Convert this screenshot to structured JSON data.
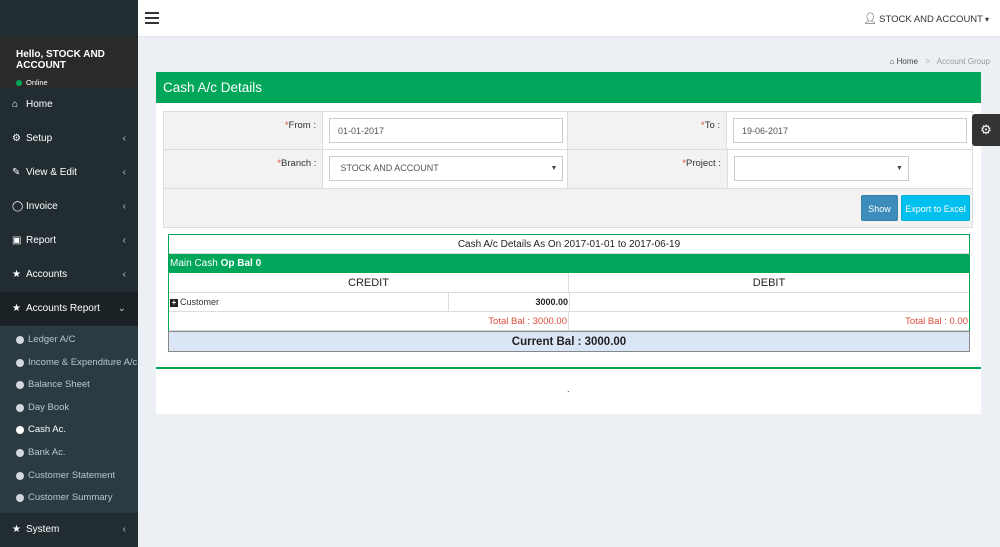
{
  "sidebar": {
    "greeting": "Hello, STOCK AND ACCOUNT",
    "status": "Online",
    "items": [
      {
        "label": "Home",
        "icon": "home-icon",
        "has_chevron": false
      },
      {
        "label": "Setup",
        "icon": "cogs-icon",
        "has_chevron": true
      },
      {
        "label": "View & Edit",
        "icon": "edit-icon",
        "has_chevron": true
      },
      {
        "label": "Invoice",
        "icon": "invoice-icon",
        "has_chevron": true
      },
      {
        "label": "Report",
        "icon": "file-icon",
        "has_chevron": true
      },
      {
        "label": "Accounts",
        "icon": "star-icon",
        "has_chevron": true
      },
      {
        "label": "Accounts Report",
        "icon": "star-icon",
        "has_chevron": true
      },
      {
        "label": "System",
        "icon": "star-icon",
        "has_chevron": true
      }
    ],
    "submenu": [
      "Ledger A/C",
      "Income & Expenditure A/c",
      "Balance Sheet",
      "Day Book",
      "Cash Ac.",
      "Bank Ac.",
      "Customer Statement",
      "Customer Summary"
    ]
  },
  "header": {
    "user_label": "STOCK AND ACCOUNT"
  },
  "breadcrumb": {
    "home": "Home",
    "current": "Account Group"
  },
  "page": {
    "title": "Cash A/c Details"
  },
  "filter": {
    "required_mark": "*",
    "from_label": "From :",
    "from_value": "01-01-2017",
    "to_label": "To :",
    "to_value": "19-06-2017",
    "branch_label": "Branch :",
    "branch_value": "STOCK AND ACCOUNT",
    "project_label": "Project :",
    "project_value": "",
    "show_button": "Show",
    "export_button": "Export to Excel"
  },
  "report": {
    "title": "Cash A/c Details As On 2017-01-01 to 2017-06-19",
    "account_name": "Main Cash",
    "op_bal_label": "Op Bal 0",
    "credit_header": "CREDIT",
    "debit_header": "DEBIT",
    "rows": [
      {
        "name": "Customer",
        "amount": "3000.00"
      }
    ],
    "credit_total": "Total Bal : 3000.00",
    "debit_total": "Total Bal : 0.00",
    "current_bal": "Current Bal : 3000.00"
  },
  "footer": {
    "text": "."
  },
  "colors": {
    "primary": "#00a65a",
    "sidebar_bg": "#222d32",
    "show_button": "#3c8dbc",
    "export_button": "#00c0ef",
    "total_text": "#dd4b39"
  }
}
